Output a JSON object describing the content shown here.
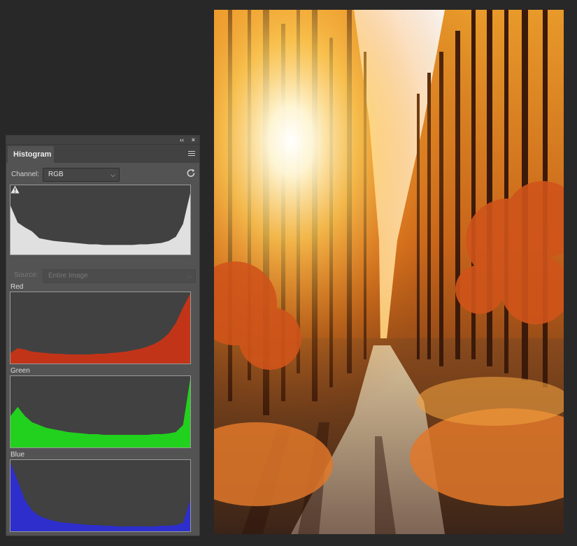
{
  "panel": {
    "collapse_glyph": "‹‹",
    "close_glyph": "×",
    "tab_label": "Histogram",
    "menu_icon": "panel-menu-icon",
    "channel_label": "Channel:",
    "channel_value": "RGB",
    "refresh_icon": "refresh-icon",
    "warning_icon": "cache-warning-icon",
    "source_label": "Source:",
    "source_value": "Entire Image",
    "histograms": {
      "composite": {
        "color": "#e0e0e0",
        "levels": [
          0.72,
          0.47,
          0.4,
          0.34,
          0.24,
          0.22,
          0.2,
          0.19,
          0.18,
          0.17,
          0.16,
          0.15,
          0.15,
          0.14,
          0.14,
          0.14,
          0.14,
          0.14,
          0.15,
          0.15,
          0.16,
          0.17,
          0.2,
          0.26,
          0.45,
          0.9
        ]
      },
      "red": {
        "label": "Red",
        "color": "#c23418",
        "levels": [
          0.15,
          0.22,
          0.2,
          0.17,
          0.16,
          0.15,
          0.14,
          0.14,
          0.13,
          0.13,
          0.13,
          0.13,
          0.14,
          0.14,
          0.15,
          0.16,
          0.17,
          0.19,
          0.21,
          0.24,
          0.28,
          0.34,
          0.43,
          0.58,
          0.8,
          1.0
        ]
      },
      "green": {
        "label": "Green",
        "color": "#22d01e",
        "levels": [
          0.45,
          0.58,
          0.45,
          0.36,
          0.32,
          0.28,
          0.26,
          0.24,
          0.22,
          0.21,
          0.2,
          0.19,
          0.19,
          0.18,
          0.18,
          0.18,
          0.18,
          0.18,
          0.18,
          0.18,
          0.19,
          0.19,
          0.2,
          0.22,
          0.32,
          0.98
        ]
      },
      "blue": {
        "label": "Blue",
        "color": "#2d2ecc",
        "levels": [
          0.98,
          0.72,
          0.45,
          0.3,
          0.22,
          0.18,
          0.15,
          0.13,
          0.12,
          0.11,
          0.1,
          0.09,
          0.09,
          0.08,
          0.08,
          0.07,
          0.07,
          0.07,
          0.07,
          0.07,
          0.07,
          0.08,
          0.08,
          0.09,
          0.12,
          0.45
        ]
      }
    }
  },
  "image": {
    "description_icon": "forest-photo"
  }
}
